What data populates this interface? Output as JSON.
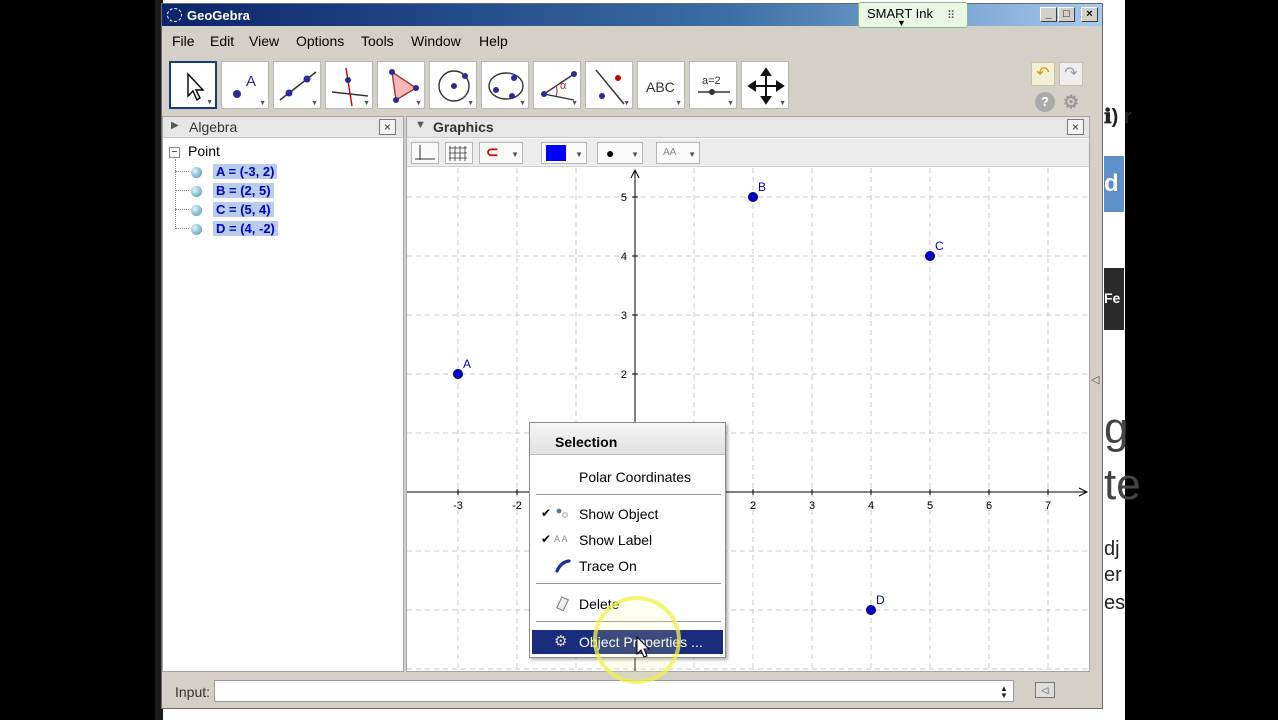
{
  "window": {
    "title": "GeoGebra"
  },
  "smart_ink": {
    "label": "SMART Ink"
  },
  "menu": [
    "File",
    "Edit",
    "View",
    "Options",
    "Tools",
    "Window",
    "Help"
  ],
  "tools": [
    {
      "name": "move-tool",
      "icon": "arrow-cursor-icon"
    },
    {
      "name": "point-tool",
      "icon": "point-icon",
      "label": "A"
    },
    {
      "name": "line-tool",
      "icon": "line-icon"
    },
    {
      "name": "perpendicular-tool",
      "icon": "perpendicular-icon"
    },
    {
      "name": "polygon-tool",
      "icon": "polygon-icon"
    },
    {
      "name": "circle-tool",
      "icon": "circle-icon"
    },
    {
      "name": "conic-tool",
      "icon": "ellipse-icon"
    },
    {
      "name": "angle-tool",
      "icon": "angle-icon",
      "label": "α"
    },
    {
      "name": "reflect-tool",
      "icon": "reflect-icon"
    },
    {
      "name": "text-tool",
      "icon": "text-icon",
      "label": "ABC"
    },
    {
      "name": "slider-tool",
      "icon": "slider-icon",
      "label": "a=2"
    },
    {
      "name": "move-graphics-tool",
      "icon": "move-arrows-icon"
    }
  ],
  "algebra": {
    "title": "Algebra",
    "group": "Point",
    "items": [
      "A = (-3, 2)",
      "B = (2, 5)",
      "C = (5, 4)",
      "D = (4, -2)"
    ]
  },
  "graphics": {
    "title": "Graphics",
    "accent_color": "#0000ff"
  },
  "chart_data": {
    "type": "scatter",
    "title": "",
    "xlabel": "",
    "ylabel": "",
    "x_ticks": [
      -3,
      -2,
      2,
      3,
      4,
      5,
      6,
      7
    ],
    "y_ticks": [
      2,
      3,
      4,
      5
    ],
    "series": [
      {
        "points": [
          {
            "label": "A",
            "x": -3,
            "y": 2
          },
          {
            "label": "B",
            "x": 2,
            "y": 5
          },
          {
            "label": "C",
            "x": 5,
            "y": 4
          },
          {
            "label": "D",
            "x": 4,
            "y": -2
          }
        ]
      }
    ],
    "point_color": "#0000cc",
    "grid": true,
    "grid_style": "dashed"
  },
  "context_menu": {
    "header": "Selection",
    "items": [
      {
        "label": "Polar Coordinates",
        "checked": false,
        "icon": ""
      },
      {
        "label": "Show Object",
        "checked": true,
        "icon": "show-object-icon"
      },
      {
        "label": "Show Label",
        "checked": true,
        "icon": "show-label-icon"
      },
      {
        "label": "Trace On",
        "checked": false,
        "icon": "trace-icon"
      },
      {
        "label": "Delete",
        "checked": false,
        "icon": "eraser-icon"
      },
      {
        "label": "Object Properties ...",
        "checked": false,
        "icon": "gear-icon",
        "highlighted": true
      }
    ]
  },
  "input_bar": {
    "label": "Input:",
    "value": ""
  },
  "background_page": {
    "fragments": [
      "ℹ) r",
      "d",
      "Fe",
      "g",
      "te",
      "dj",
      "er",
      "es"
    ]
  }
}
